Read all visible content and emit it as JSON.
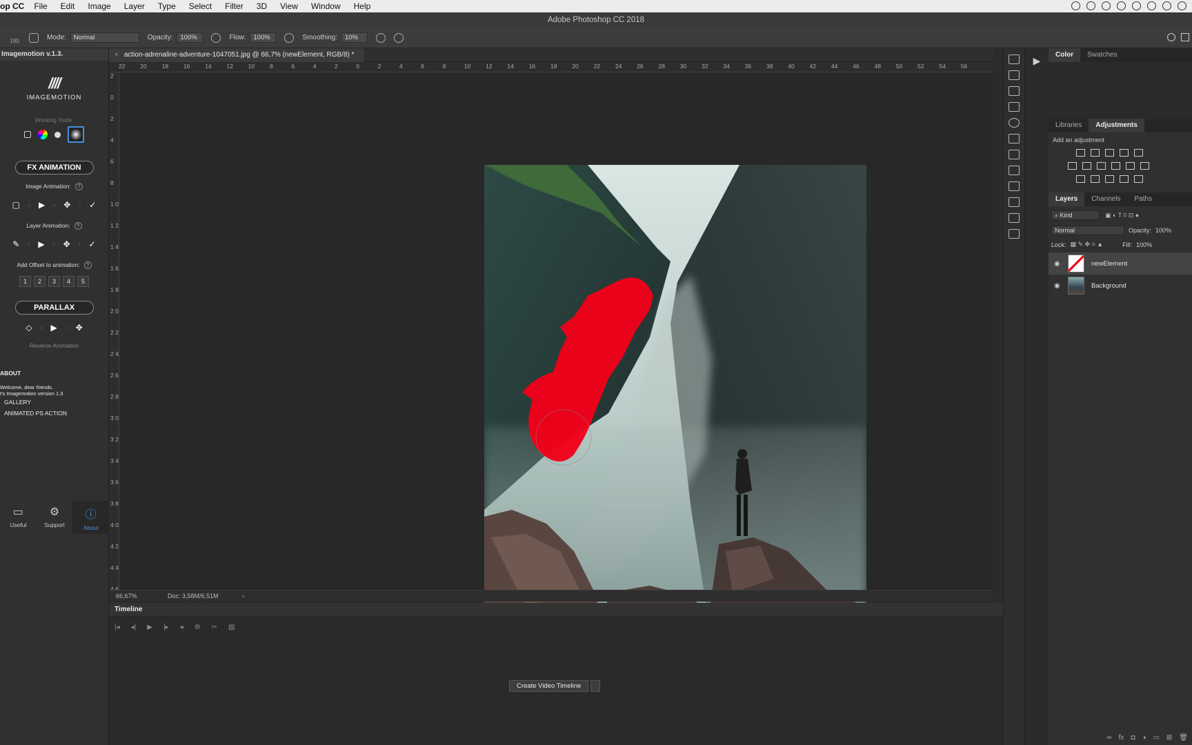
{
  "menubar": {
    "app": "op CC",
    "items": [
      "File",
      "Edit",
      "Image",
      "Layer",
      "Type",
      "Select",
      "Filter",
      "3D",
      "View",
      "Window",
      "Help"
    ]
  },
  "window_title": "Adobe Photoshop CC 2018",
  "options": {
    "brush_size": "190",
    "mode_label": "Mode:",
    "mode_value": "Normal",
    "opacity_label": "Opacity:",
    "opacity_value": "100%",
    "flow_label": "Flow:",
    "flow_value": "100%",
    "smoothing_label": "Smoothing:",
    "smoothing_value": "10%"
  },
  "plugin": {
    "header": "Imagemotion v.1.3.",
    "logo_text": "IMAGEMOTION",
    "working_tools": "Working Tools:",
    "fx_animation": "FX ANIMATION",
    "image_animation": "Image Animation:",
    "layer_animation": "Layer Animation:",
    "offset": "Add Offset to animation:",
    "offset_nums": [
      "1",
      "2",
      "3",
      "4",
      "5"
    ],
    "parallax": "PARALLAX",
    "reverse": "Reverse Animation",
    "about": "ABOUT",
    "welcome1": "Welcome, dear friends.",
    "welcome2": "t's Imagemotion version 1.3",
    "gallery": "GALLERY",
    "animated": "ANIMATED PS ACTION",
    "bottom": {
      "useful": "Useful",
      "support": "Support",
      "about": "About"
    }
  },
  "document": {
    "tab_title": "action-adrenaline-adventure-1047051.jpg @ 66,7% (newElement, RGB/8) *",
    "zoom": "66,67%",
    "doc_size": "Doc: 3,58M/6,51M",
    "ruler_h": [
      "22",
      "20",
      "18",
      "16",
      "14",
      "12",
      "10",
      "8",
      "6",
      "4",
      "2",
      "0",
      "2",
      "4",
      "6",
      "8",
      "10",
      "12",
      "14",
      "16",
      "18",
      "20",
      "22",
      "24",
      "26",
      "28",
      "30",
      "32",
      "34",
      "36",
      "38",
      "40",
      "42",
      "44",
      "46",
      "48",
      "50",
      "52",
      "54",
      "56"
    ],
    "ruler_v": [
      "2",
      "0",
      "2",
      "4",
      "6",
      "8",
      "1 0",
      "1 2",
      "1 4",
      "1 6",
      "1 8",
      "2 0",
      "2 2",
      "2 4",
      "2 6",
      "2 8",
      "3 0",
      "3 2",
      "3 4",
      "3 6",
      "3 8",
      "4 0",
      "4 2",
      "4 4",
      "4 6"
    ]
  },
  "timeline": {
    "title": "Timeline",
    "create_button": "Create Video Timeline"
  },
  "right": {
    "tabs_top": [
      "Color",
      "Swatches"
    ],
    "tabs_mid": [
      "Libraries",
      "Adjustments"
    ],
    "add_adjustment": "Add an adjustment",
    "tabs_layers": [
      "Layers",
      "Channels",
      "Paths"
    ],
    "kind": "Kind",
    "blend": "Normal",
    "opacity_label": "Opacity:",
    "opacity_value": "100%",
    "lock_label": "Lock:",
    "fill_label": "Fill:",
    "fill_value": "100%",
    "layers": [
      "newElement",
      "Background"
    ]
  },
  "colors": {
    "mask_red": "#f2001a",
    "accent_blue": "#4a90e2"
  }
}
